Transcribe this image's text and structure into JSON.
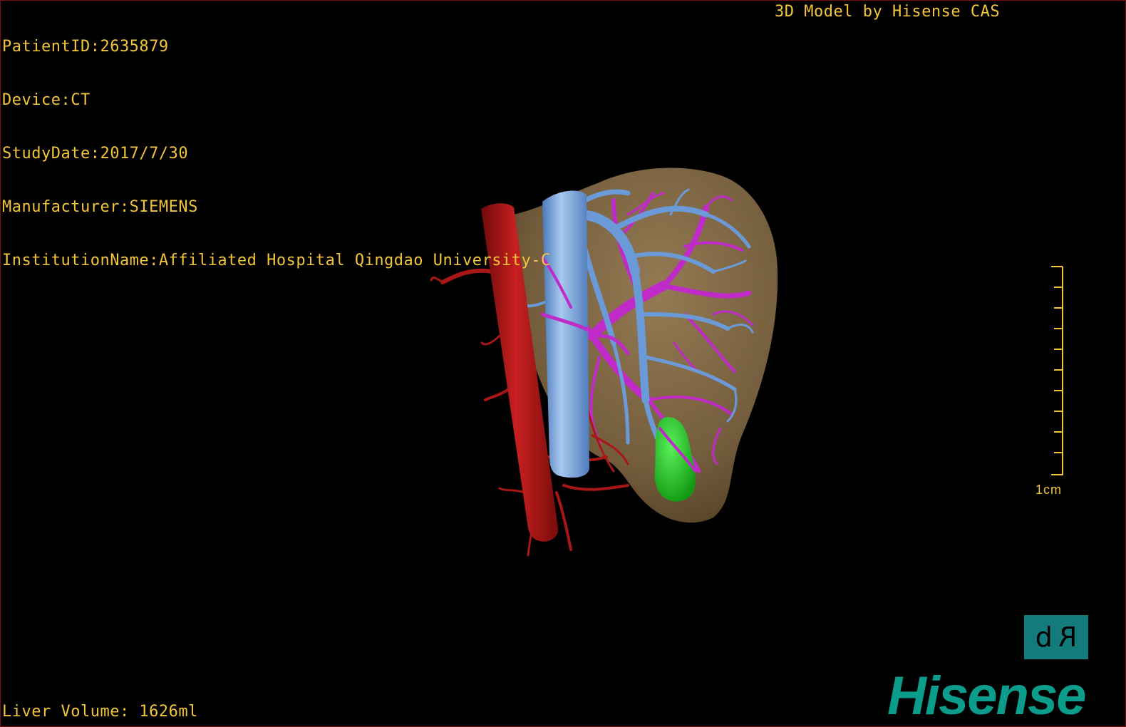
{
  "header": {
    "patient_id": "PatientID:2635879",
    "device": "Device:CT",
    "study_date": "StudyDate:2017/7/30",
    "manufacturer": "Manufacturer:SIEMENS",
    "institution": "InstitutionName:Affiliated Hospital Qingdao University-C"
  },
  "credit": "3D Model by Hisense CAS",
  "footer": {
    "liver_volume": "Liver Volume: 1626ml"
  },
  "scale": {
    "label": "1cm",
    "color": "#f2c53a"
  },
  "orientation": {
    "left_letter": "d",
    "right_letter": "R"
  },
  "brand": "Hisense",
  "colors": {
    "overlay_text": "#f2c53a",
    "liver": "#8a7048",
    "artery": "#b01818",
    "ivc_vein": "#6a9ad8",
    "portal_vein": "#c02ac8",
    "gallbladder": "#22c022",
    "orient_cube": "#137b7b",
    "brand": "#0b9c8b",
    "frame": "#7a1010"
  },
  "structures": [
    "liver-parenchyma",
    "abdominal-aorta",
    "inferior-vena-cava",
    "hepatic-vein-branches",
    "portal-vein-branches",
    "gallbladder"
  ]
}
